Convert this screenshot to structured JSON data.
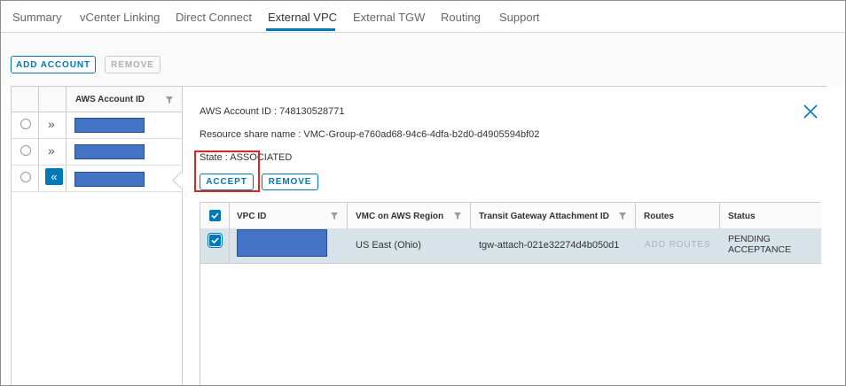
{
  "tabs": [
    {
      "label": "Summary"
    },
    {
      "label": "vCenter Linking"
    },
    {
      "label": "Direct Connect"
    },
    {
      "label": "External VPC",
      "active": true
    },
    {
      "label": "External TGW"
    },
    {
      "label": "Routing"
    },
    {
      "label": "Support"
    }
  ],
  "toolbar": {
    "add_account_label": "ADD ACCOUNT",
    "remove_label": "REMOVE"
  },
  "accounts_grid": {
    "column_header": "AWS Account ID",
    "rows": [
      {
        "selected": false,
        "expanded": false,
        "account_id_redacted": true
      },
      {
        "selected": false,
        "expanded": false,
        "account_id_redacted": true
      },
      {
        "selected": false,
        "expanded": true,
        "account_id_redacted": true
      }
    ]
  },
  "detail": {
    "account_label": "AWS Account ID : ",
    "account_value": "748130528771",
    "share_label": "Resource share name : ",
    "share_value": "VMC-Group-e760ad68-94c6-4dfa-b2d0-d4905594bf02",
    "state_label": "State : ",
    "state_value": "ASSOCIATED",
    "accept_label": "ACCEPT",
    "remove_label": "REMOVE"
  },
  "vpc_grid": {
    "columns": [
      "VPC ID",
      "VMC on AWS Region",
      "Transit Gateway Attachment ID",
      "Routes",
      "Status"
    ],
    "rows": [
      {
        "checked": true,
        "vpc_id_redacted": true,
        "region": "US East (Ohio)",
        "attachment_id": "tgw-attach-021e32274d4b050d1",
        "routes_action": "ADD ROUTES",
        "status_line1": "PENDING",
        "status_line2": "ACCEPTANCE"
      }
    ]
  },
  "colors": {
    "accent": "#0079b8",
    "redaction": "#4472c4",
    "highlight": "#e0251f",
    "selected_row": "#d8e3e9"
  }
}
